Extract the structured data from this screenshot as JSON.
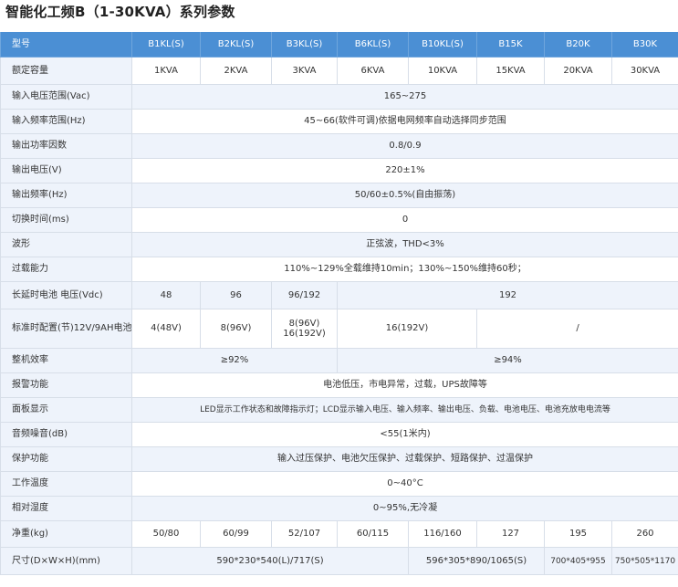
{
  "title": "智能化工频B（1-30KVA）系列参数",
  "header": {
    "label": "型号",
    "models": [
      "B1KL(S)",
      "B2KL(S)",
      "B3KL(S)",
      "B6KL(S)",
      "B10KL(S)",
      "B15K",
      "B20K",
      "B30K"
    ]
  },
  "rows": {
    "capacity": {
      "label": "额定容量",
      "values": [
        "1KVA",
        "2KVA",
        "3KVA",
        "6KVA",
        "10KVA",
        "15KVA",
        "20KVA",
        "30KVA"
      ]
    },
    "input_voltage": {
      "label": "输入电压范围(Vac)",
      "value": "165~275"
    },
    "input_frequency": {
      "label": "输入频率范围(Hz)",
      "value": "45~66(软件可调)依据电网频率自动选择同步范围"
    },
    "power_factor": {
      "label": "输出功率因数",
      "value": "0.8/0.9"
    },
    "output_voltage": {
      "label": "输出电压(V)",
      "value": "220±1%"
    },
    "output_frequency": {
      "label": "输出频率(Hz)",
      "value": "50/60±0.5%(自由振荡)"
    },
    "transfer_time": {
      "label": "切换时间(ms)",
      "value": "0"
    },
    "waveform": {
      "label": "波形",
      "value": "正弦波，THD<3%"
    },
    "overload": {
      "label": "过载能力",
      "value": "110%~129%全载维持10min；130%~150%维持60秒；"
    },
    "battery_voltage": {
      "label": "长延时电池 电压(Vdc)",
      "v1": "48",
      "v2": "96",
      "v3": "96/192",
      "v4": "192"
    },
    "battery_config": {
      "label": "标准时配置(节)12V/9AH电池",
      "v1": "4(48V)",
      "v2": "8(96V)",
      "v3a": "8(96V)",
      "v3b": "16(192V)",
      "v4": "16(192V)",
      "v5": "/"
    },
    "efficiency": {
      "label": "整机效率",
      "v1": "≥92%",
      "v2": "≥94%"
    },
    "alarm": {
      "label": "报警功能",
      "value": "电池低压，市电异常，过载，UPS故障等"
    },
    "panel": {
      "label": "面板显示",
      "value": "LED显示工作状态和故障指示灯；LCD显示输入电压、输入频率、输出电压、负载、电池电压、电池充放电电流等"
    },
    "noise": {
      "label": "音频噪音(dB)",
      "value": "<55(1米内)"
    },
    "protection": {
      "label": "保护功能",
      "value": "输入过压保护、电池欠压保护、过载保护、短路保护、过温保护"
    },
    "temperature": {
      "label": "工作温度",
      "value": "0~40°C"
    },
    "humidity": {
      "label": "相对湿度",
      "value": "0~95%,无冷凝"
    },
    "weight": {
      "label": "净重(kg)",
      "values": [
        "50/80",
        "60/99",
        "52/107",
        "60/115",
        "116/160",
        "127",
        "195",
        "260"
      ]
    },
    "dimensions": {
      "label": "尺寸(D×W×H)(mm)",
      "v1": "590*230*540(L)/717(S)",
      "v2": "596*305*890/1065(S)",
      "v3": "700*405*955",
      "v4": "750*505*1170"
    }
  }
}
